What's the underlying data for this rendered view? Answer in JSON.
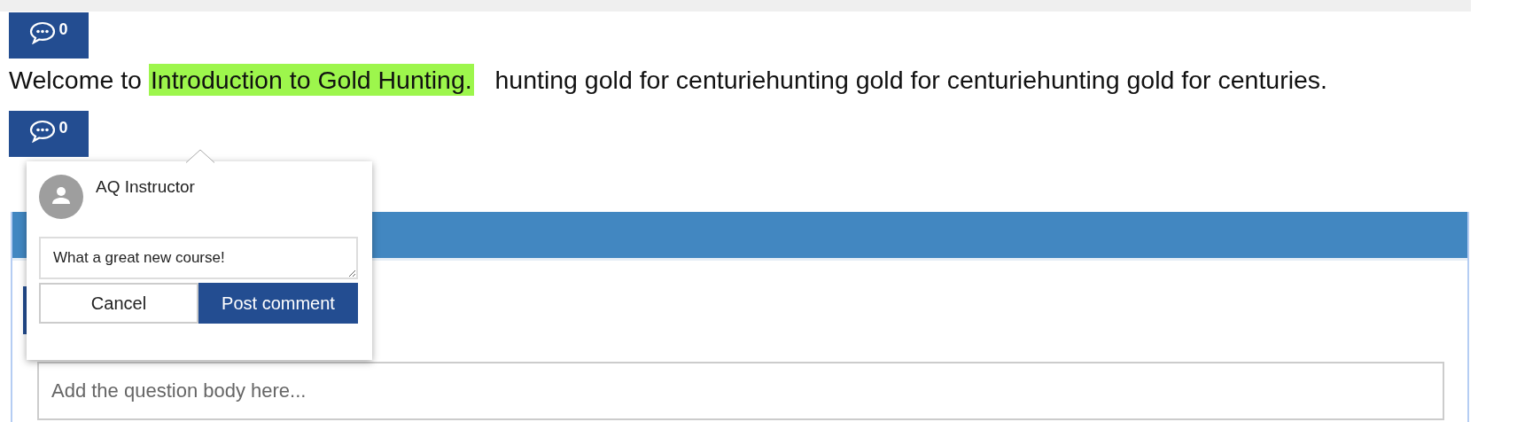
{
  "comment_buttons": [
    {
      "count": "0"
    },
    {
      "count": "0"
    }
  ],
  "paragraph": {
    "lead": "Welcome to",
    "highlight": "Introduction to Gold Hunting.",
    "rest": "hunting gold for centuriehunting gold for centuriehunting gold for centuries."
  },
  "comment_popover": {
    "author": "AQ Instructor",
    "comment": "What a great new course!",
    "buttons": [
      {
        "label": "Cancel",
        "kind": "secondary"
      },
      {
        "label": "Post comment",
        "kind": "primary"
      }
    ]
  },
  "question_form": {
    "body": {
      "placeholder": "Add the question body here..."
    }
  }
}
